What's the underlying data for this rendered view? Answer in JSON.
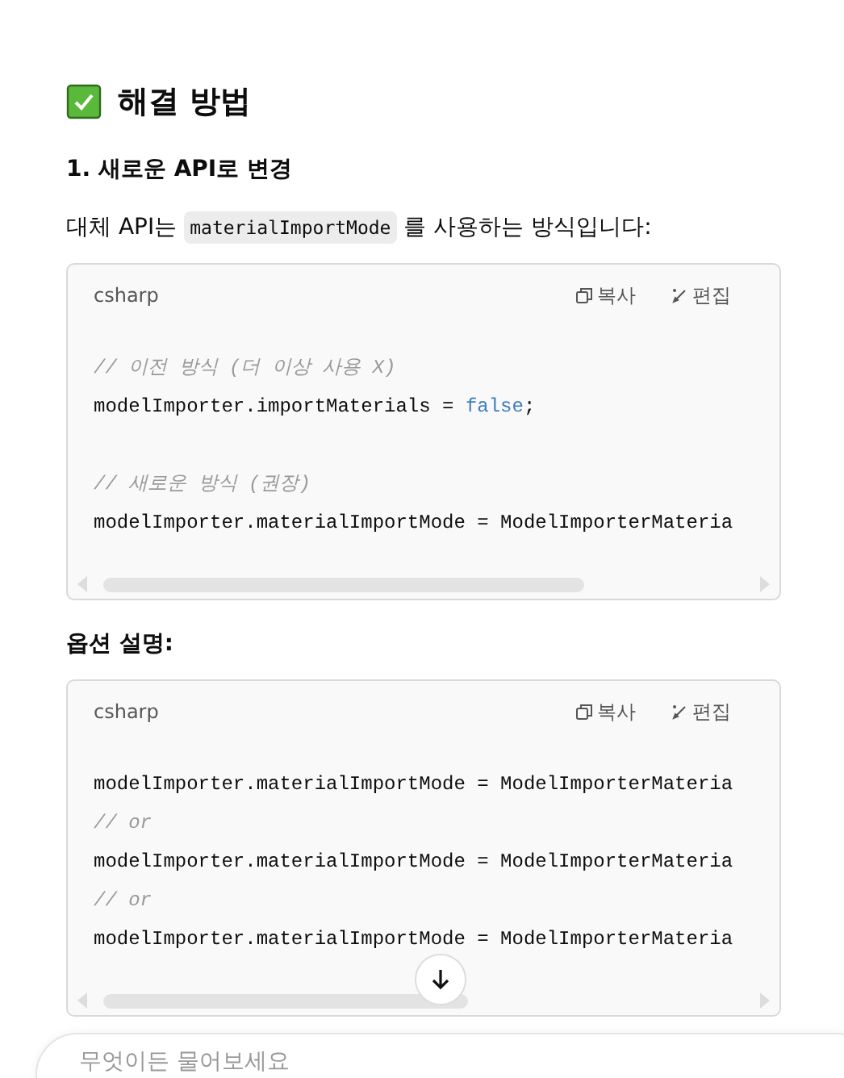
{
  "section": {
    "title": "해결 방법"
  },
  "step": {
    "title": "1. 새로운 **API**로 변경"
  },
  "intro": {
    "before": "대체 API는",
    "code": "materialImportMode",
    "after": "를 사용하는 방식입니다:"
  },
  "blocks": [
    {
      "language": "csharp",
      "copy": "복사",
      "edit": "편집",
      "lines": [
        {
          "kind": "blank"
        },
        {
          "kind": "comment",
          "parts": [
            {
              "kind": "plain",
              "text": "// 이전 방식 (더 이상 사용 X)"
            }
          ]
        },
        {
          "kind": "code",
          "parts": [
            {
              "kind": "plain",
              "text": "modelImporter.importMaterials = "
            },
            {
              "kind": "keyword",
              "text": "false"
            },
            {
              "kind": "plain",
              "text": ";"
            }
          ]
        },
        {
          "kind": "blank"
        },
        {
          "kind": "comment",
          "parts": [
            {
              "kind": "plain",
              "text": "// 새로운 방식 (권장)"
            }
          ]
        },
        {
          "kind": "code",
          "parts": [
            {
              "kind": "plain",
              "text": "modelImporter.materialImportMode = ModelImporterMateria"
            }
          ]
        }
      ]
    },
    {
      "heading": "옵션 설명:",
      "language": "csharp",
      "copy": "복사",
      "edit": "편집",
      "lines": [
        {
          "kind": "blank"
        },
        {
          "kind": "code",
          "parts": [
            {
              "kind": "plain",
              "text": "modelImporter.materialImportMode = ModelImporterMateria"
            }
          ]
        },
        {
          "kind": "comment",
          "parts": [
            {
              "kind": "plain",
              "text": "// or"
            }
          ]
        },
        {
          "kind": "code",
          "parts": [
            {
              "kind": "plain",
              "text": "modelImporter.materialImportMode = ModelImporterMateria"
            }
          ]
        },
        {
          "kind": "comment",
          "parts": [
            {
              "kind": "plain",
              "text": "// or"
            }
          ]
        },
        {
          "kind": "code",
          "parts": [
            {
              "kind": "plain",
              "text": "modelImporter.materialImportMode = ModelImporterMateria"
            }
          ]
        }
      ]
    }
  ],
  "composer": {
    "placeholder": "무엇이든 물어보세요"
  }
}
